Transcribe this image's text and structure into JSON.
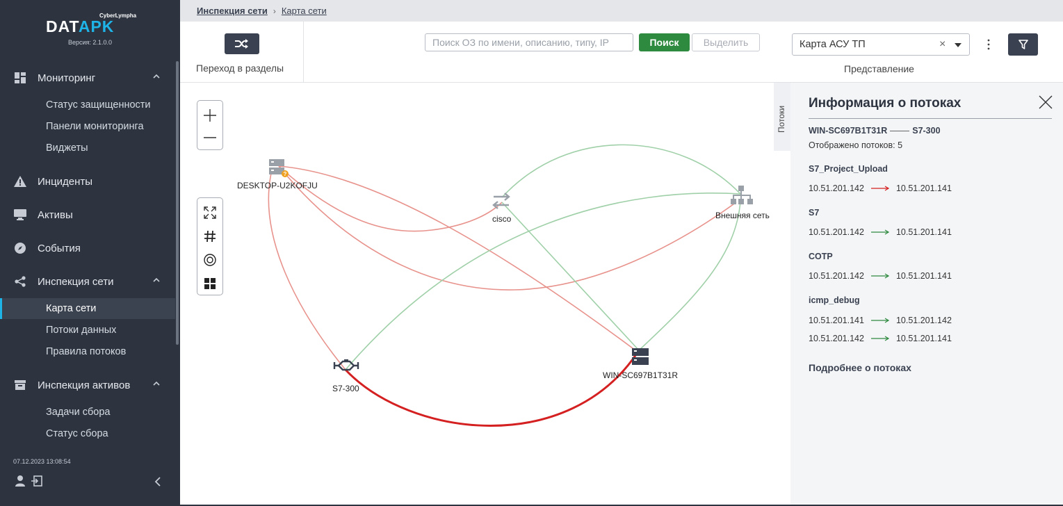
{
  "app": {
    "brand_top": "CyberLympha",
    "brand_a": "DAT",
    "brand_b": "APK",
    "version": "Версия: 2.1.0.0",
    "accent_color": "#1fb4e8"
  },
  "sidebar": {
    "sections": [
      {
        "label": "Мониторинг",
        "icon": "dashboard-icon",
        "expanded": true,
        "items": [
          "Статус защищенности",
          "Панели мониторинга",
          "Виджеты"
        ]
      },
      {
        "label": "Инциденты",
        "icon": "warning-icon"
      },
      {
        "label": "Активы",
        "icon": "monitor-icon"
      },
      {
        "label": "События",
        "icon": "compass-icon"
      },
      {
        "label": "Инспекция сети",
        "icon": "share-icon",
        "expanded": true,
        "items": [
          "Карта сети",
          "Потоки данных",
          "Правила потоков"
        ],
        "active_item": "Карта сети"
      },
      {
        "label": "Инспекция активов",
        "icon": "archive-icon",
        "expanded": true,
        "items": [
          "Задачи сбора",
          "Статус сбора"
        ]
      }
    ],
    "datetime": "07.12.2023   13:08:54"
  },
  "breadcrumb": {
    "items": [
      "Инспекция сети",
      "Карта сети"
    ]
  },
  "toolbar": {
    "nav_label": "Переход в разделы",
    "search_placeholder": "Поиск ОЗ по имени, описанию, типу, IP",
    "search_button": "Поиск",
    "select_button": "Выделить",
    "view_value": "Карта АСУ ТП",
    "view_clear": "×",
    "view_label": "Представление"
  },
  "map": {
    "nodes": [
      {
        "id": "desktop",
        "label": "DESKTOP-U2KOFJU",
        "icon": "server-icon"
      },
      {
        "id": "cisco",
        "label": "cisco",
        "icon": "switch-icon"
      },
      {
        "id": "external",
        "label": "Внешняя сеть",
        "icon": "network-icon"
      },
      {
        "id": "s7",
        "label": "S7-300",
        "icon": "plc-icon"
      },
      {
        "id": "win",
        "label": "WIN-SC697B1T31R",
        "icon": "server-icon"
      }
    ],
    "colors": {
      "red_link": "#e8928c",
      "green_link": "#9fd0a8",
      "selected_link": "#d42020"
    }
  },
  "flows_tab": {
    "label": "Потоки"
  },
  "panel": {
    "title": "Информация о потоках",
    "pair_left": "WIN-SC697B1T31R",
    "pair_right": "S7-300",
    "count": "Отображено потоков: 5",
    "flows": [
      {
        "name": "S7_Project_Upload",
        "rows": [
          {
            "src": "10.51.201.142",
            "dst": "10.51.201.141",
            "color": "#d42020"
          }
        ]
      },
      {
        "name": "S7",
        "rows": [
          {
            "src": "10.51.201.142",
            "dst": "10.51.201.141",
            "color": "#2e8a3f"
          }
        ]
      },
      {
        "name": "COTP",
        "rows": [
          {
            "src": "10.51.201.142",
            "dst": "10.51.201.141",
            "color": "#2e8a3f"
          }
        ]
      },
      {
        "name": "icmp_debug",
        "rows": [
          {
            "src": "10.51.201.141",
            "dst": "10.51.201.142",
            "color": "#2e8a3f"
          },
          {
            "src": "10.51.201.142",
            "dst": "10.51.201.141",
            "color": "#2e8a3f"
          }
        ]
      }
    ],
    "more_link": "Подробнее о потоках"
  }
}
